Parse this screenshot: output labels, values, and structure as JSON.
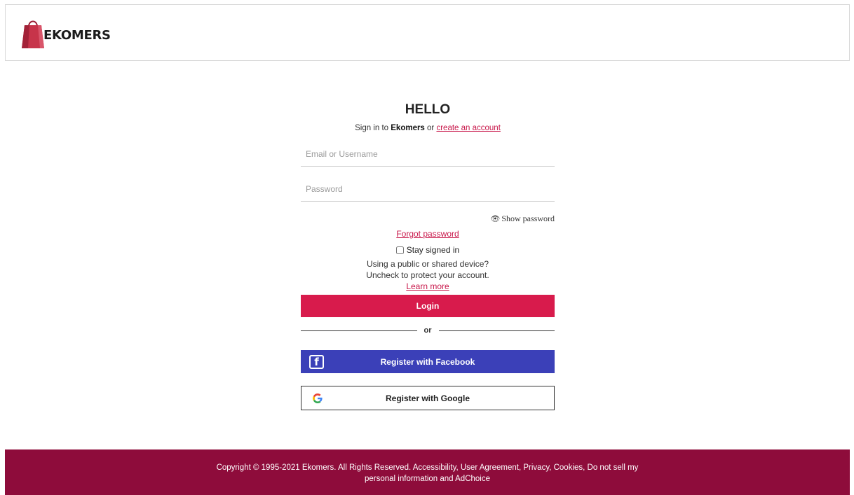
{
  "header": {
    "logo_text": "EKOMERS"
  },
  "login": {
    "title": "HELLO",
    "subtitle_prefix": "Sign in to ",
    "subtitle_brand": "Ekomers",
    "subtitle_or": " or ",
    "create_account_link": "create an account",
    "email_placeholder": "Email or Username",
    "password_placeholder": "Password",
    "show_password_label": "Show password",
    "forgot_password_link": "Forgot password",
    "stay_signed_in_label": "Stay signed in",
    "info_line1": "Using a public or shared device?",
    "info_line2": "Uncheck to protect your account.",
    "learn_more_link": "Learn more",
    "login_button": "Login",
    "divider_text": "or",
    "facebook_button": "Register with Facebook",
    "google_button": "Register with Google"
  },
  "footer": {
    "text": "Copyright © 1995-2021 Ekomers. All Rights Reserved. Accessibility, User Agreement, Privacy, Cookies, Do not sell my personal information and AdChoice"
  },
  "colors": {
    "brand_primary": "#d81b4c",
    "facebook_blue": "#3b40b8",
    "footer_bg": "#8e0c3b",
    "link": "#c8174a"
  }
}
